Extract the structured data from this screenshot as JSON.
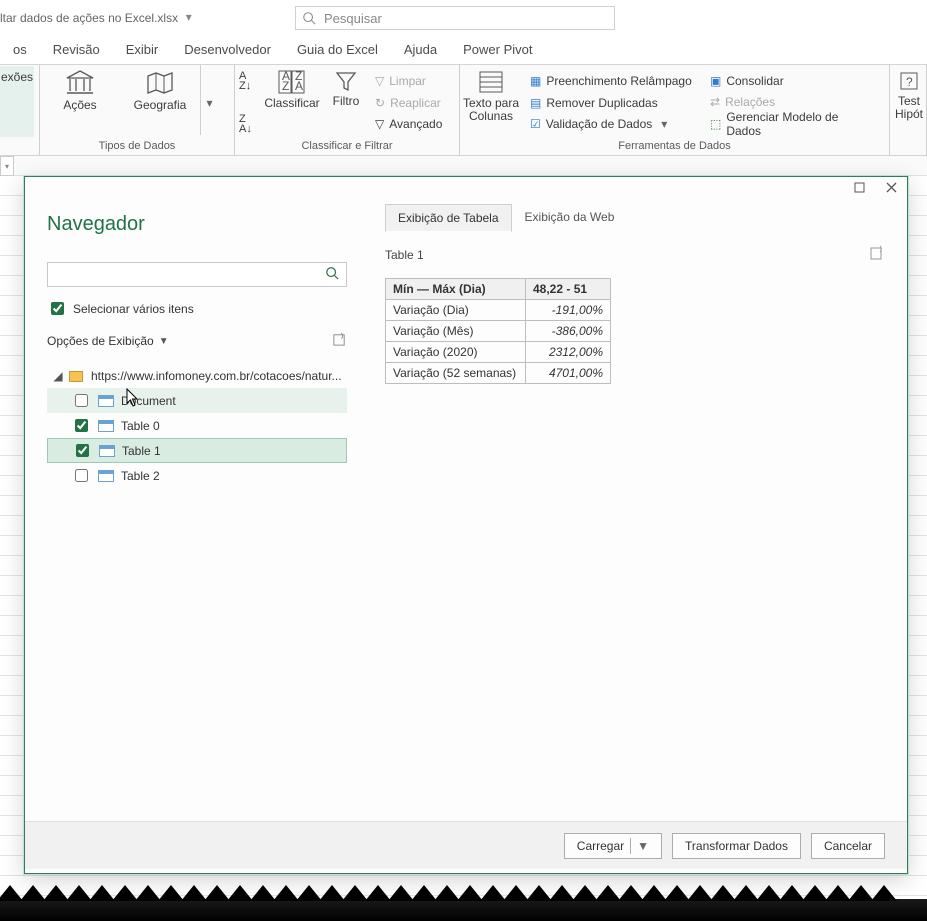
{
  "titlebar": {
    "doc_title": "ltar dados de ações no Excel.xlsx"
  },
  "search": {
    "placeholder": "Pesquisar"
  },
  "tabs": [
    "os",
    "Revisão",
    "Exibir",
    "Desenvolvedor",
    "Guia do Excel",
    "Ajuda",
    "Power Pivot"
  ],
  "ribbon": {
    "conn": "exões",
    "data_types": {
      "acoes": "Ações",
      "geografia": "Geografia",
      "group": "Tipos de Dados"
    },
    "sort_filter": {
      "classificar": "Classificar",
      "filtro": "Filtro",
      "limpar": "Limpar",
      "reaplicar": "Reaplicar",
      "avancado": "Avançado",
      "group": "Classificar e Filtrar"
    },
    "data_tools": {
      "texto_colunas_l1": "Texto para",
      "texto_colunas_l2": "Colunas",
      "preench": "Preenchimento Relâmpago",
      "remover_dup": "Remover Duplicadas",
      "valid": "Validação de Dados",
      "consolidar": "Consolidar",
      "relacoes": "Relações",
      "modelo": "Gerenciar Modelo de Dados",
      "group": "Ferramentas de Dados"
    },
    "forecast": {
      "teste_l1": "Test",
      "teste_l2": "Hipót"
    }
  },
  "dialog": {
    "title": "Navegador",
    "select_multi": "Selecionar vários itens",
    "display_opt": "Opções de Exibição",
    "url": "https://www.infomoney.com.br/cotacoes/natur...",
    "tree": [
      {
        "label": "Document",
        "checked": false,
        "sel": "A"
      },
      {
        "label": "Table 0",
        "checked": true,
        "sel": ""
      },
      {
        "label": "Table 1",
        "checked": true,
        "sel": "B"
      },
      {
        "label": "Table 2",
        "checked": false,
        "sel": ""
      }
    ],
    "view_tabs": {
      "a": "Exibição de Tabela",
      "b": "Exibição da Web"
    },
    "preview_title": "Table 1",
    "table": {
      "head": [
        "Mín — Máx (Dia)",
        "48,22 - 51"
      ],
      "rows": [
        [
          "Variação (Dia)",
          "-191,00%"
        ],
        [
          "Variação (Mês)",
          "-386,00%"
        ],
        [
          "Variação (2020)",
          "2312,00%"
        ],
        [
          "Variação (52 semanas)",
          "4701,00%"
        ]
      ]
    },
    "buttons": {
      "load": "Carregar",
      "transform": "Transformar Dados",
      "cancel": "Cancelar"
    }
  }
}
